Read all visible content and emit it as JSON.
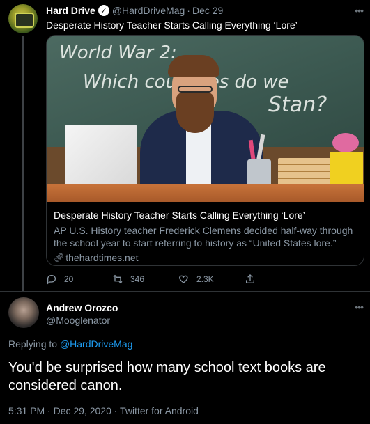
{
  "parent_tweet": {
    "author_name": "Hard Drive",
    "author_handle": "@HardDriveMag",
    "separator": "·",
    "date": "Dec 29",
    "text": "Desperate History Teacher Starts Calling Everything ‘Lore’",
    "card": {
      "image_text_line1": "World War 2:",
      "image_text_line2": "Which countries do we",
      "image_text_line3": "Stan?",
      "title": "Desperate History Teacher Starts Calling Everything ‘Lore’",
      "description": "AP U.S. History teacher Frederick Clemens decided half-way through the school year to start referring to history as “United States lore.”",
      "link": "thehardtimes.net"
    },
    "actions": {
      "reply_count": "20",
      "retweet_count": "346",
      "like_count": "2.3K"
    },
    "icons": {
      "verified": "verified-badge-icon",
      "more": "more-options-icon",
      "reply": "reply-icon",
      "retweet": "retweet-icon",
      "like": "heart-icon",
      "share": "share-icon",
      "link": "link-icon"
    }
  },
  "reply_tweet": {
    "author_name": "Andrew Orozco",
    "author_handle": "@Mooglenator",
    "replying_prefix": "Replying to",
    "replying_to": "@HardDriveMag",
    "text": "You'd be surprised how many school text books are considered canon.",
    "meta": "5:31 PM · Dec 29, 2020 · Twitter for Android"
  },
  "colors": {
    "background": "#000000",
    "accent": "#1d9bf0",
    "secondary_text": "#8b98a5",
    "border": "#2f3336"
  }
}
